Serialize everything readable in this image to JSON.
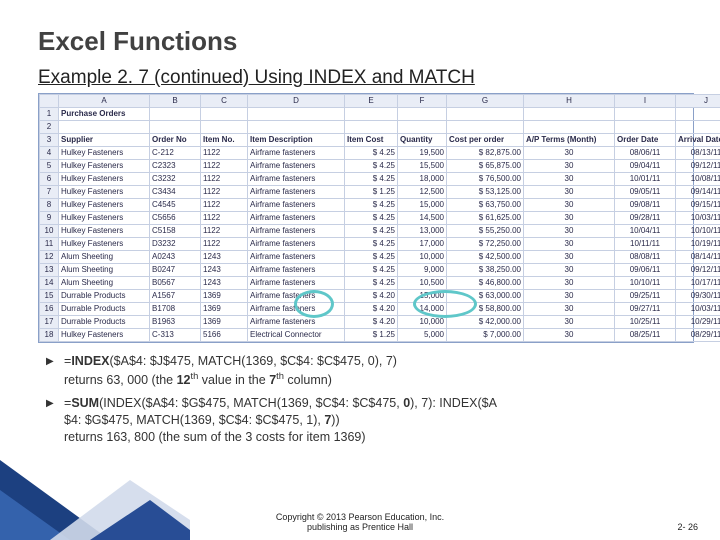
{
  "title": "Excel Functions",
  "subtitle": "Example 2. 7  (continued) Using INDEX and MATCH",
  "columns": [
    "A",
    "B",
    "C",
    "D",
    "E",
    "F",
    "G",
    "H",
    "I",
    "J"
  ],
  "header_row": [
    "Supplier",
    "Order No",
    "Item No.",
    "Item Description",
    "Item Cost",
    "Quantity",
    "Cost per order",
    "A/P Terms (Month)",
    "Order Date",
    "Arrival Date"
  ],
  "pre_rows": [
    [
      "Purchase Orders",
      "",
      "",
      "",
      "",
      "",
      "",
      "",
      "",
      ""
    ],
    [
      "",
      "",
      "",
      "",
      "",
      "",
      "",
      "",
      "",
      ""
    ]
  ],
  "data_rows": [
    [
      "Hulkey Fasteners",
      "C-212",
      "1122",
      "Airframe fasteners",
      "$  4.25",
      "19,500",
      "$   82,875.00",
      "30",
      "08/06/11",
      "08/13/11"
    ],
    [
      "Hulkey Fasteners",
      "C2323",
      "1122",
      "Airframe fasteners",
      "$  4.25",
      "15,500",
      "$   65,875.00",
      "30",
      "09/04/11",
      "09/12/11"
    ],
    [
      "Hulkey Fasteners",
      "C3232",
      "1122",
      "Airframe fasteners",
      "$  4.25",
      "18,000",
      "$   76,500.00",
      "30",
      "10/01/11",
      "10/08/11"
    ],
    [
      "Hulkey Fasteners",
      "C3434",
      "1122",
      "Airframe fasteners",
      "$  1.25",
      "12,500",
      "$   53,125.00",
      "30",
      "09/05/11",
      "09/14/11"
    ],
    [
      "Hulkey Fasteners",
      "C4545",
      "1122",
      "Airframe fasteners",
      "$  4.25",
      "15,000",
      "$   63,750.00",
      "30",
      "09/08/11",
      "09/15/11"
    ],
    [
      "Hulkey Fasteners",
      "C5656",
      "1122",
      "Airframe fasteners",
      "$  4.25",
      "14,500",
      "$   61,625.00",
      "30",
      "09/28/11",
      "10/03/11"
    ],
    [
      "Hulkey Fasteners",
      "C5158",
      "1122",
      "Airframe fasteners",
      "$  4.25",
      "13,000",
      "$   55,250.00",
      "30",
      "10/04/11",
      "10/10/11"
    ],
    [
      "Hulkey Fasteners",
      "D3232",
      "1122",
      "Airframe fasteners",
      "$  4.25",
      "17,000",
      "$   72,250.00",
      "30",
      "10/11/11",
      "10/19/11"
    ],
    [
      "Alum Sheeting",
      "A0243",
      "1243",
      "Airframe fasteners",
      "$  4.25",
      "10,000",
      "$   42,500.00",
      "30",
      "08/08/11",
      "08/14/11"
    ],
    [
      "Alum Sheeting",
      "B0247",
      "1243",
      "Airframe fasteners",
      "$  4.25",
      "9,000",
      "$   38,250.00",
      "30",
      "09/06/11",
      "09/12/11"
    ],
    [
      "Alum Sheeting",
      "B0567",
      "1243",
      "Airframe fasteners",
      "$  4.25",
      "10,500",
      "$   46,800.00",
      "30",
      "10/10/11",
      "10/17/11"
    ],
    [
      "Durrable Products",
      "A1567",
      "1369",
      "Airframe fasteners",
      "$  4.20",
      "15,000",
      "$   63,000.00",
      "30",
      "09/25/11",
      "09/30/11"
    ],
    [
      "Durrable Products",
      "B1708",
      "1369",
      "Airframe fasteners",
      "$  4.20",
      "14,000",
      "$   58,800.00",
      "30",
      "09/27/11",
      "10/03/11"
    ],
    [
      "Durrable Products",
      "B1963",
      "1369",
      "Airframe fasteners",
      "$  4.20",
      "10,000",
      "$   42,000.00",
      "30",
      "10/25/11",
      "10/29/11"
    ],
    [
      "Hulkey Fasteners",
      "C-313",
      "5166",
      "Electrical Connector",
      "$  1.25",
      "5,000",
      "$    7,000.00",
      "30",
      "08/25/11",
      "08/29/11"
    ]
  ],
  "bullets": [
    {
      "formula_prefix": "=",
      "formula_bold": "INDEX",
      "formula_rest": "($A$4: $J$475, MATCH(1369, $C$4: $C$475, 0), 7)",
      "returns_prefix": "returns 63, 000 (the ",
      "bold1": "12",
      "sup1": "th",
      "mid": " value in the ",
      "bold2": "7",
      "sup2": "th",
      "tail": " column)"
    },
    {
      "line1_prefix": "=",
      "line1_bold1": "SUM",
      "line1_mid1": "(INDEX($A$4: $G$475, MATCH(1369, $C$4: $C$475, ",
      "line1_bold2": "0",
      "line1_mid2": "), 7): INDEX($A",
      "line2": "$4: $G$475, MATCH(1369, $C$4: $C$475, 1), ",
      "line2_bold": "7",
      "line2_end": "))",
      "returns": "returns 163, 800 (the sum of the 3 costs for item 1369)"
    }
  ],
  "footer": {
    "copyright1": "Copyright © 2013 Pearson Education, Inc.",
    "copyright2": "publishing as Prentice Hall",
    "page": "2- 26"
  }
}
